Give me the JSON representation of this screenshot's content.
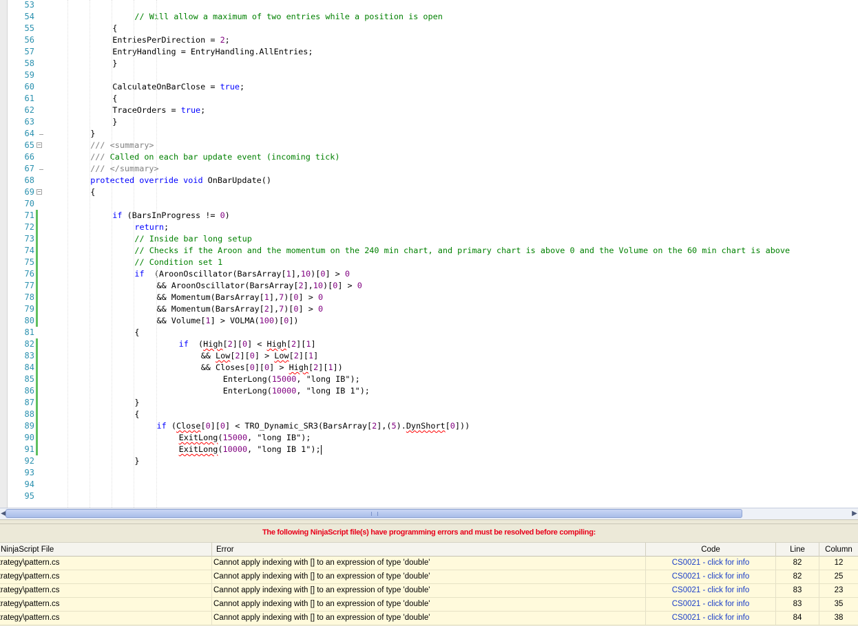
{
  "editor": {
    "lines": [
      {
        "n": "53",
        "segs": []
      },
      {
        "n": "54",
        "segs": [
          {
            "i": 4,
            "t": "// Will allow a maximum of two entries while a position is open",
            "c": "cm"
          }
        ]
      },
      {
        "n": "55",
        "segs": [
          {
            "i": 3,
            "t": "{",
            "c": ""
          }
        ]
      },
      {
        "n": "56",
        "segs": [
          {
            "i": 3,
            "t": "EntriesPerDirection = ",
            "c": ""
          },
          {
            "t": "2",
            "c": "num"
          },
          {
            "t": ";",
            "c": ""
          }
        ]
      },
      {
        "n": "57",
        "segs": [
          {
            "i": 3,
            "t": "EntryHandling = EntryHandling.AllEntries;",
            "c": ""
          }
        ]
      },
      {
        "n": "58",
        "segs": [
          {
            "i": 3,
            "t": "}",
            "c": ""
          }
        ]
      },
      {
        "n": "59",
        "segs": []
      },
      {
        "n": "60",
        "segs": [
          {
            "i": 3,
            "t": "CalculateOnBarClose = ",
            "c": ""
          },
          {
            "t": "true",
            "c": "kw"
          },
          {
            "t": ";",
            "c": ""
          }
        ]
      },
      {
        "n": "61",
        "segs": [
          {
            "i": 3,
            "t": "{",
            "c": ""
          }
        ]
      },
      {
        "n": "62",
        "segs": [
          {
            "i": 3,
            "t": "TraceOrders = ",
            "c": ""
          },
          {
            "t": "true",
            "c": "kw"
          },
          {
            "t": ";",
            "c": ""
          }
        ]
      },
      {
        "n": "63",
        "segs": [
          {
            "i": 3,
            "t": "}",
            "c": ""
          }
        ]
      },
      {
        "n": "64",
        "segs": [
          {
            "i": 2,
            "t": "}",
            "c": ""
          }
        ]
      },
      {
        "n": "65",
        "segs": [
          {
            "i": 2,
            "t": "/// ",
            "c": "xd"
          },
          {
            "t": "<summary>",
            "c": "xd"
          }
        ]
      },
      {
        "n": "66",
        "segs": [
          {
            "i": 2,
            "t": "/// ",
            "c": "xd"
          },
          {
            "t": "Called on each bar update event (incoming tick)",
            "c": "cm"
          }
        ]
      },
      {
        "n": "67",
        "segs": [
          {
            "i": 2,
            "t": "/// ",
            "c": "xd"
          },
          {
            "t": "</summary>",
            "c": "xd"
          }
        ]
      },
      {
        "n": "68",
        "segs": [
          {
            "i": 2,
            "t": "protected override void",
            "c": "kw"
          },
          {
            "t": " OnBarUpdate()",
            "c": ""
          }
        ]
      },
      {
        "n": "69",
        "segs": [
          {
            "i": 2,
            "t": "{",
            "c": ""
          }
        ]
      },
      {
        "n": "70",
        "segs": []
      },
      {
        "n": "71",
        "segs": [
          {
            "i": 3,
            "t": "if",
            "c": "kw"
          },
          {
            "t": " (BarsInProgress != ",
            "c": ""
          },
          {
            "t": "0",
            "c": "num"
          },
          {
            "t": ")",
            "c": ""
          }
        ]
      },
      {
        "n": "72",
        "segs": [
          {
            "i": 4,
            "t": "return",
            "c": "kw"
          },
          {
            "t": ";",
            "c": ""
          }
        ]
      },
      {
        "n": "73",
        "segs": [
          {
            "i": 4,
            "t": "// Inside bar long setup",
            "c": "cm"
          }
        ]
      },
      {
        "n": "74",
        "segs": [
          {
            "i": 4,
            "t": "// Checks if the Aroon and the momentum on the 240 min chart, and primary chart is above 0 and the Volume on the 60 min chart is above",
            "c": "cm"
          }
        ]
      },
      {
        "n": "75",
        "segs": [
          {
            "i": 4,
            "t": "// Condition set 1",
            "c": "cm"
          }
        ]
      },
      {
        "n": "76",
        "segs": [
          {
            "i": 4,
            "t": "if",
            "c": "kw"
          },
          {
            "t": "  (AroonOscillator(BarsArray[",
            "c": ""
          },
          {
            "t": "1",
            "c": "num"
          },
          {
            "t": "],",
            "c": ""
          },
          {
            "t": "10",
            "c": "num"
          },
          {
            "t": ")[",
            "c": ""
          },
          {
            "t": "0",
            "c": "num"
          },
          {
            "t": "] > ",
            "c": ""
          },
          {
            "t": "0",
            "c": "num"
          }
        ]
      },
      {
        "n": "77",
        "segs": [
          {
            "i": 5,
            "t": "&& AroonOscillator(BarsArray[",
            "c": ""
          },
          {
            "t": "2",
            "c": "num"
          },
          {
            "t": "],",
            "c": ""
          },
          {
            "t": "10",
            "c": "num"
          },
          {
            "t": ")[",
            "c": ""
          },
          {
            "t": "0",
            "c": "num"
          },
          {
            "t": "] > ",
            "c": ""
          },
          {
            "t": "0",
            "c": "num"
          }
        ]
      },
      {
        "n": "78",
        "segs": [
          {
            "i": 5,
            "t": "&& Momentum(BarsArray[",
            "c": ""
          },
          {
            "t": "1",
            "c": "num"
          },
          {
            "t": "],",
            "c": ""
          },
          {
            "t": "7",
            "c": "num"
          },
          {
            "t": ")[",
            "c": ""
          },
          {
            "t": "0",
            "c": "num"
          },
          {
            "t": "] > ",
            "c": ""
          },
          {
            "t": "0",
            "c": "num"
          }
        ]
      },
      {
        "n": "79",
        "segs": [
          {
            "i": 5,
            "t": "&& Momentum(BarsArray[",
            "c": ""
          },
          {
            "t": "2",
            "c": "num"
          },
          {
            "t": "],",
            "c": ""
          },
          {
            "t": "7",
            "c": "num"
          },
          {
            "t": ")[",
            "c": ""
          },
          {
            "t": "0",
            "c": "num"
          },
          {
            "t": "] > ",
            "c": ""
          },
          {
            "t": "0",
            "c": "num"
          }
        ]
      },
      {
        "n": "80",
        "segs": [
          {
            "i": 5,
            "t": "&& Volume[",
            "c": ""
          },
          {
            "t": "1",
            "c": "num"
          },
          {
            "t": "] > VOLMA(",
            "c": ""
          },
          {
            "t": "100",
            "c": "num"
          },
          {
            "t": ")[",
            "c": ""
          },
          {
            "t": "0",
            "c": "num"
          },
          {
            "t": "])",
            "c": ""
          }
        ]
      },
      {
        "n": "81",
        "segs": [
          {
            "i": 4,
            "t": "{",
            "c": ""
          }
        ]
      },
      {
        "n": "82",
        "segs": [
          {
            "i": 6,
            "t": "if",
            "c": "kw"
          },
          {
            "t": "  (",
            "c": ""
          },
          {
            "t": "High",
            "c": "sq"
          },
          {
            "t": "[",
            "c": ""
          },
          {
            "t": "2",
            "c": "num"
          },
          {
            "t": "][",
            "c": ""
          },
          {
            "t": "0",
            "c": "num"
          },
          {
            "t": "] < ",
            "c": ""
          },
          {
            "t": "High",
            "c": "sq"
          },
          {
            "t": "[",
            "c": ""
          },
          {
            "t": "2",
            "c": "num"
          },
          {
            "t": "][",
            "c": ""
          },
          {
            "t": "1",
            "c": "num"
          },
          {
            "t": "]",
            "c": ""
          }
        ]
      },
      {
        "n": "83",
        "segs": [
          {
            "i": 7,
            "t": "&& ",
            "c": ""
          },
          {
            "t": "Low",
            "c": "sq"
          },
          {
            "t": "[",
            "c": ""
          },
          {
            "t": "2",
            "c": "num"
          },
          {
            "t": "][",
            "c": ""
          },
          {
            "t": "0",
            "c": "num"
          },
          {
            "t": "] > ",
            "c": ""
          },
          {
            "t": "Low",
            "c": "sq"
          },
          {
            "t": "[",
            "c": ""
          },
          {
            "t": "2",
            "c": "num"
          },
          {
            "t": "][",
            "c": ""
          },
          {
            "t": "1",
            "c": "num"
          },
          {
            "t": "]",
            "c": ""
          }
        ]
      },
      {
        "n": "84",
        "segs": [
          {
            "i": 7,
            "t": "&& Closes[",
            "c": ""
          },
          {
            "t": "0",
            "c": "num"
          },
          {
            "t": "][",
            "c": ""
          },
          {
            "t": "0",
            "c": "num"
          },
          {
            "t": "] > ",
            "c": ""
          },
          {
            "t": "High",
            "c": "sq"
          },
          {
            "t": "[",
            "c": ""
          },
          {
            "t": "2",
            "c": "num"
          },
          {
            "t": "][",
            "c": ""
          },
          {
            "t": "1",
            "c": "num"
          },
          {
            "t": "])",
            "c": ""
          }
        ]
      },
      {
        "n": "85",
        "segs": [
          {
            "i": 8,
            "t": "EnterLong(",
            "c": ""
          },
          {
            "t": "15000",
            "c": "num"
          },
          {
            "t": ", ",
            "c": ""
          },
          {
            "t": "\"long IB\"",
            "c": "str"
          },
          {
            "t": ");",
            "c": ""
          }
        ]
      },
      {
        "n": "86",
        "segs": [
          {
            "i": 8,
            "t": "EnterLong(",
            "c": ""
          },
          {
            "t": "10000",
            "c": "num"
          },
          {
            "t": ", ",
            "c": ""
          },
          {
            "t": "\"long IB 1\"",
            "c": "str"
          },
          {
            "t": ");",
            "c": ""
          }
        ]
      },
      {
        "n": "87",
        "segs": [
          {
            "i": 4,
            "t": "}",
            "c": ""
          }
        ]
      },
      {
        "n": "88",
        "segs": [
          {
            "i": 4,
            "t": "{",
            "c": ""
          }
        ]
      },
      {
        "n": "89",
        "segs": [
          {
            "i": 5,
            "t": "if",
            "c": "kw"
          },
          {
            "t": " (",
            "c": ""
          },
          {
            "t": "Close",
            "c": "sq"
          },
          {
            "t": "[",
            "c": ""
          },
          {
            "t": "0",
            "c": "num"
          },
          {
            "t": "][",
            "c": ""
          },
          {
            "t": "0",
            "c": "num"
          },
          {
            "t": "] < TRO_Dynamic_SR3(BarsArray[",
            "c": ""
          },
          {
            "t": "2",
            "c": "num"
          },
          {
            "t": "],(",
            "c": ""
          },
          {
            "t": "5",
            "c": "num"
          },
          {
            "t": ").",
            "c": ""
          },
          {
            "t": "DynShort",
            "c": "sq"
          },
          {
            "t": "[",
            "c": ""
          },
          {
            "t": "0",
            "c": "num"
          },
          {
            "t": "]))",
            "c": ""
          }
        ]
      },
      {
        "n": "90",
        "segs": [
          {
            "i": 6,
            "t": "ExitLong",
            "c": "sq"
          },
          {
            "t": "(",
            "c": ""
          },
          {
            "t": "15000",
            "c": "num"
          },
          {
            "t": ", ",
            "c": ""
          },
          {
            "t": "\"long IB\"",
            "c": "str"
          },
          {
            "t": ");",
            "c": ""
          }
        ]
      },
      {
        "n": "91",
        "segs": [
          {
            "i": 6,
            "t": "ExitLong",
            "c": "sq"
          },
          {
            "t": "(",
            "c": ""
          },
          {
            "t": "10000",
            "c": "num"
          },
          {
            "t": ", ",
            "c": ""
          },
          {
            "t": "\"long IB 1\"",
            "c": "str"
          },
          {
            "t": ");",
            "c": ""
          },
          {
            "t": "",
            "c": "caret"
          }
        ]
      },
      {
        "n": "92",
        "segs": [
          {
            "i": 4,
            "t": "}",
            "c": ""
          }
        ]
      },
      {
        "n": "93",
        "segs": []
      },
      {
        "n": "94",
        "segs": []
      },
      {
        "n": "95",
        "segs": []
      }
    ],
    "fold_boxes": [
      "65",
      "69"
    ],
    "fold_ends": [
      "64",
      "67"
    ]
  },
  "errors": {
    "title": "The following NinjaScript file(s) have programming errors and must be resolved before compiling:",
    "columns": {
      "file": "NinjaScript File",
      "error": "Error",
      "code": "Code",
      "line": "Line",
      "column": "Column"
    },
    "rows": [
      {
        "file": "Strategy\\pattern.cs",
        "error": "Cannot apply indexing with [] to an expression of type 'double'",
        "code": "CS0021 - click for info",
        "line": "82",
        "column": "12"
      },
      {
        "file": "Strategy\\pattern.cs",
        "error": "Cannot apply indexing with [] to an expression of type 'double'",
        "code": "CS0021 - click for info",
        "line": "82",
        "column": "25"
      },
      {
        "file": "Strategy\\pattern.cs",
        "error": "Cannot apply indexing with [] to an expression of type 'double'",
        "code": "CS0021 - click for info",
        "line": "83",
        "column": "23"
      },
      {
        "file": "Strategy\\pattern.cs",
        "error": "Cannot apply indexing with [] to an expression of type 'double'",
        "code": "CS0021 - click for info",
        "line": "83",
        "column": "35"
      },
      {
        "file": "Strategy\\pattern.cs",
        "error": "Cannot apply indexing with [] to an expression of type 'double'",
        "code": "CS0021 - click for info",
        "line": "84",
        "column": "38"
      }
    ]
  },
  "icons": {
    "scroll_left": "scroll-left-arrow-icon",
    "scroll_right": "scroll-right-arrow-icon"
  }
}
